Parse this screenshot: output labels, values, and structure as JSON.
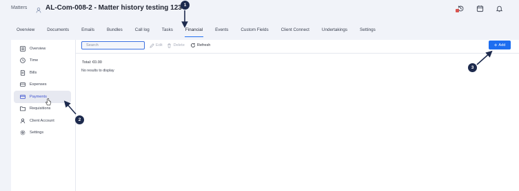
{
  "header": {
    "breadcrumb": "Matters",
    "title": "AL-Com-008-2  - Matter history testing 123",
    "icons": [
      "history-icon",
      "calendar-icon",
      "bell-icon"
    ]
  },
  "tabs": [
    {
      "label": "Overview"
    },
    {
      "label": "Documents"
    },
    {
      "label": "Emails"
    },
    {
      "label": "Bundles"
    },
    {
      "label": "Call log"
    },
    {
      "label": "Tasks"
    },
    {
      "label": "Financial",
      "active": true
    },
    {
      "label": "Events"
    },
    {
      "label": "Custom Fields"
    },
    {
      "label": "Client Connect"
    },
    {
      "label": "Undertakings"
    },
    {
      "label": "Settings"
    }
  ],
  "sidebar": {
    "items": [
      {
        "label": "Overview",
        "icon": "list-icon"
      },
      {
        "label": "Time",
        "icon": "clock-icon"
      },
      {
        "label": "Bills",
        "icon": "bill-icon"
      },
      {
        "label": "Expenses",
        "icon": "expenses-icon"
      },
      {
        "label": "Payments",
        "icon": "card-icon",
        "active": true
      },
      {
        "label": "Requisitions",
        "icon": "folder-icon"
      },
      {
        "label": "Client Account",
        "icon": "user-icon"
      },
      {
        "label": "Settings",
        "icon": "gear-icon"
      }
    ]
  },
  "toolbar": {
    "search_placeholder": "Search",
    "edit_label": "Edit",
    "delete_label": "Delete",
    "refresh_label": "Refresh",
    "add_label": "Add"
  },
  "content": {
    "total": "Total: €0.00",
    "empty_message": "No results to display"
  },
  "annotations": [
    "1",
    "2",
    "3"
  ],
  "colors": {
    "accent": "#1e6ef0",
    "active_text": "#3a4fd0",
    "badge": "#1d2a4d"
  }
}
